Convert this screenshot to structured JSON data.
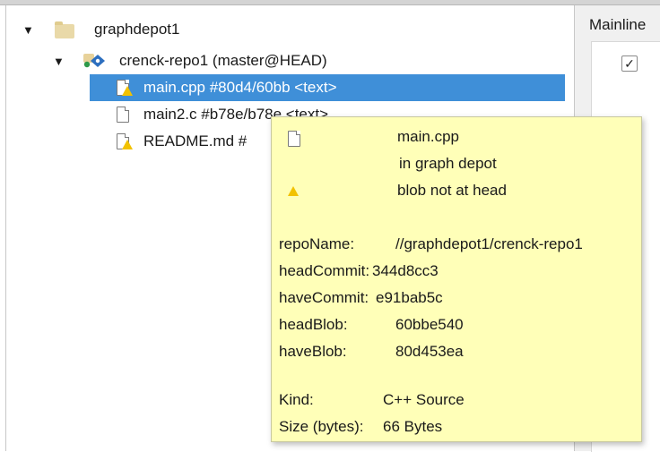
{
  "tree": {
    "root": {
      "label": "graphdepot1",
      "icon": "folder-icon"
    },
    "repo": {
      "label": "crenck-repo1 (master@HEAD)",
      "icon": "repository-icon"
    },
    "files": [
      {
        "label": "main.cpp #80d4/60bb <text>",
        "icon": "file-warning-icon",
        "selected": true
      },
      {
        "label": "main2.c #b78e/b78e <text>",
        "icon": "file-icon",
        "selected": false
      },
      {
        "label": "README.md #",
        "icon": "file-warning-icon",
        "selected": false
      }
    ]
  },
  "right_panel": {
    "column_header": "Mainline",
    "checkbox_checked": true
  },
  "tooltip": {
    "file_name": "main.cpp",
    "location": "in graph depot",
    "status": "blob not at head",
    "fields": [
      {
        "key": "repoName:",
        "value": "//graphdepot1/crenck-repo1"
      },
      {
        "key": "headCommit:",
        "value": "344d8cc3"
      },
      {
        "key": "haveCommit:",
        "value": "e91bab5c"
      },
      {
        "key": "headBlob:",
        "value": "60bbe540"
      },
      {
        "key": "haveBlob:",
        "value": "80d453ea"
      }
    ],
    "kind": {
      "key": "Kind:",
      "value": "C++ Source"
    },
    "size": {
      "key": "Size (bytes):",
      "value": "66 Bytes"
    }
  },
  "colors": {
    "selection": "#3f8fd8",
    "tooltip_bg": "#ffffb8",
    "warning": "#f2c200"
  }
}
